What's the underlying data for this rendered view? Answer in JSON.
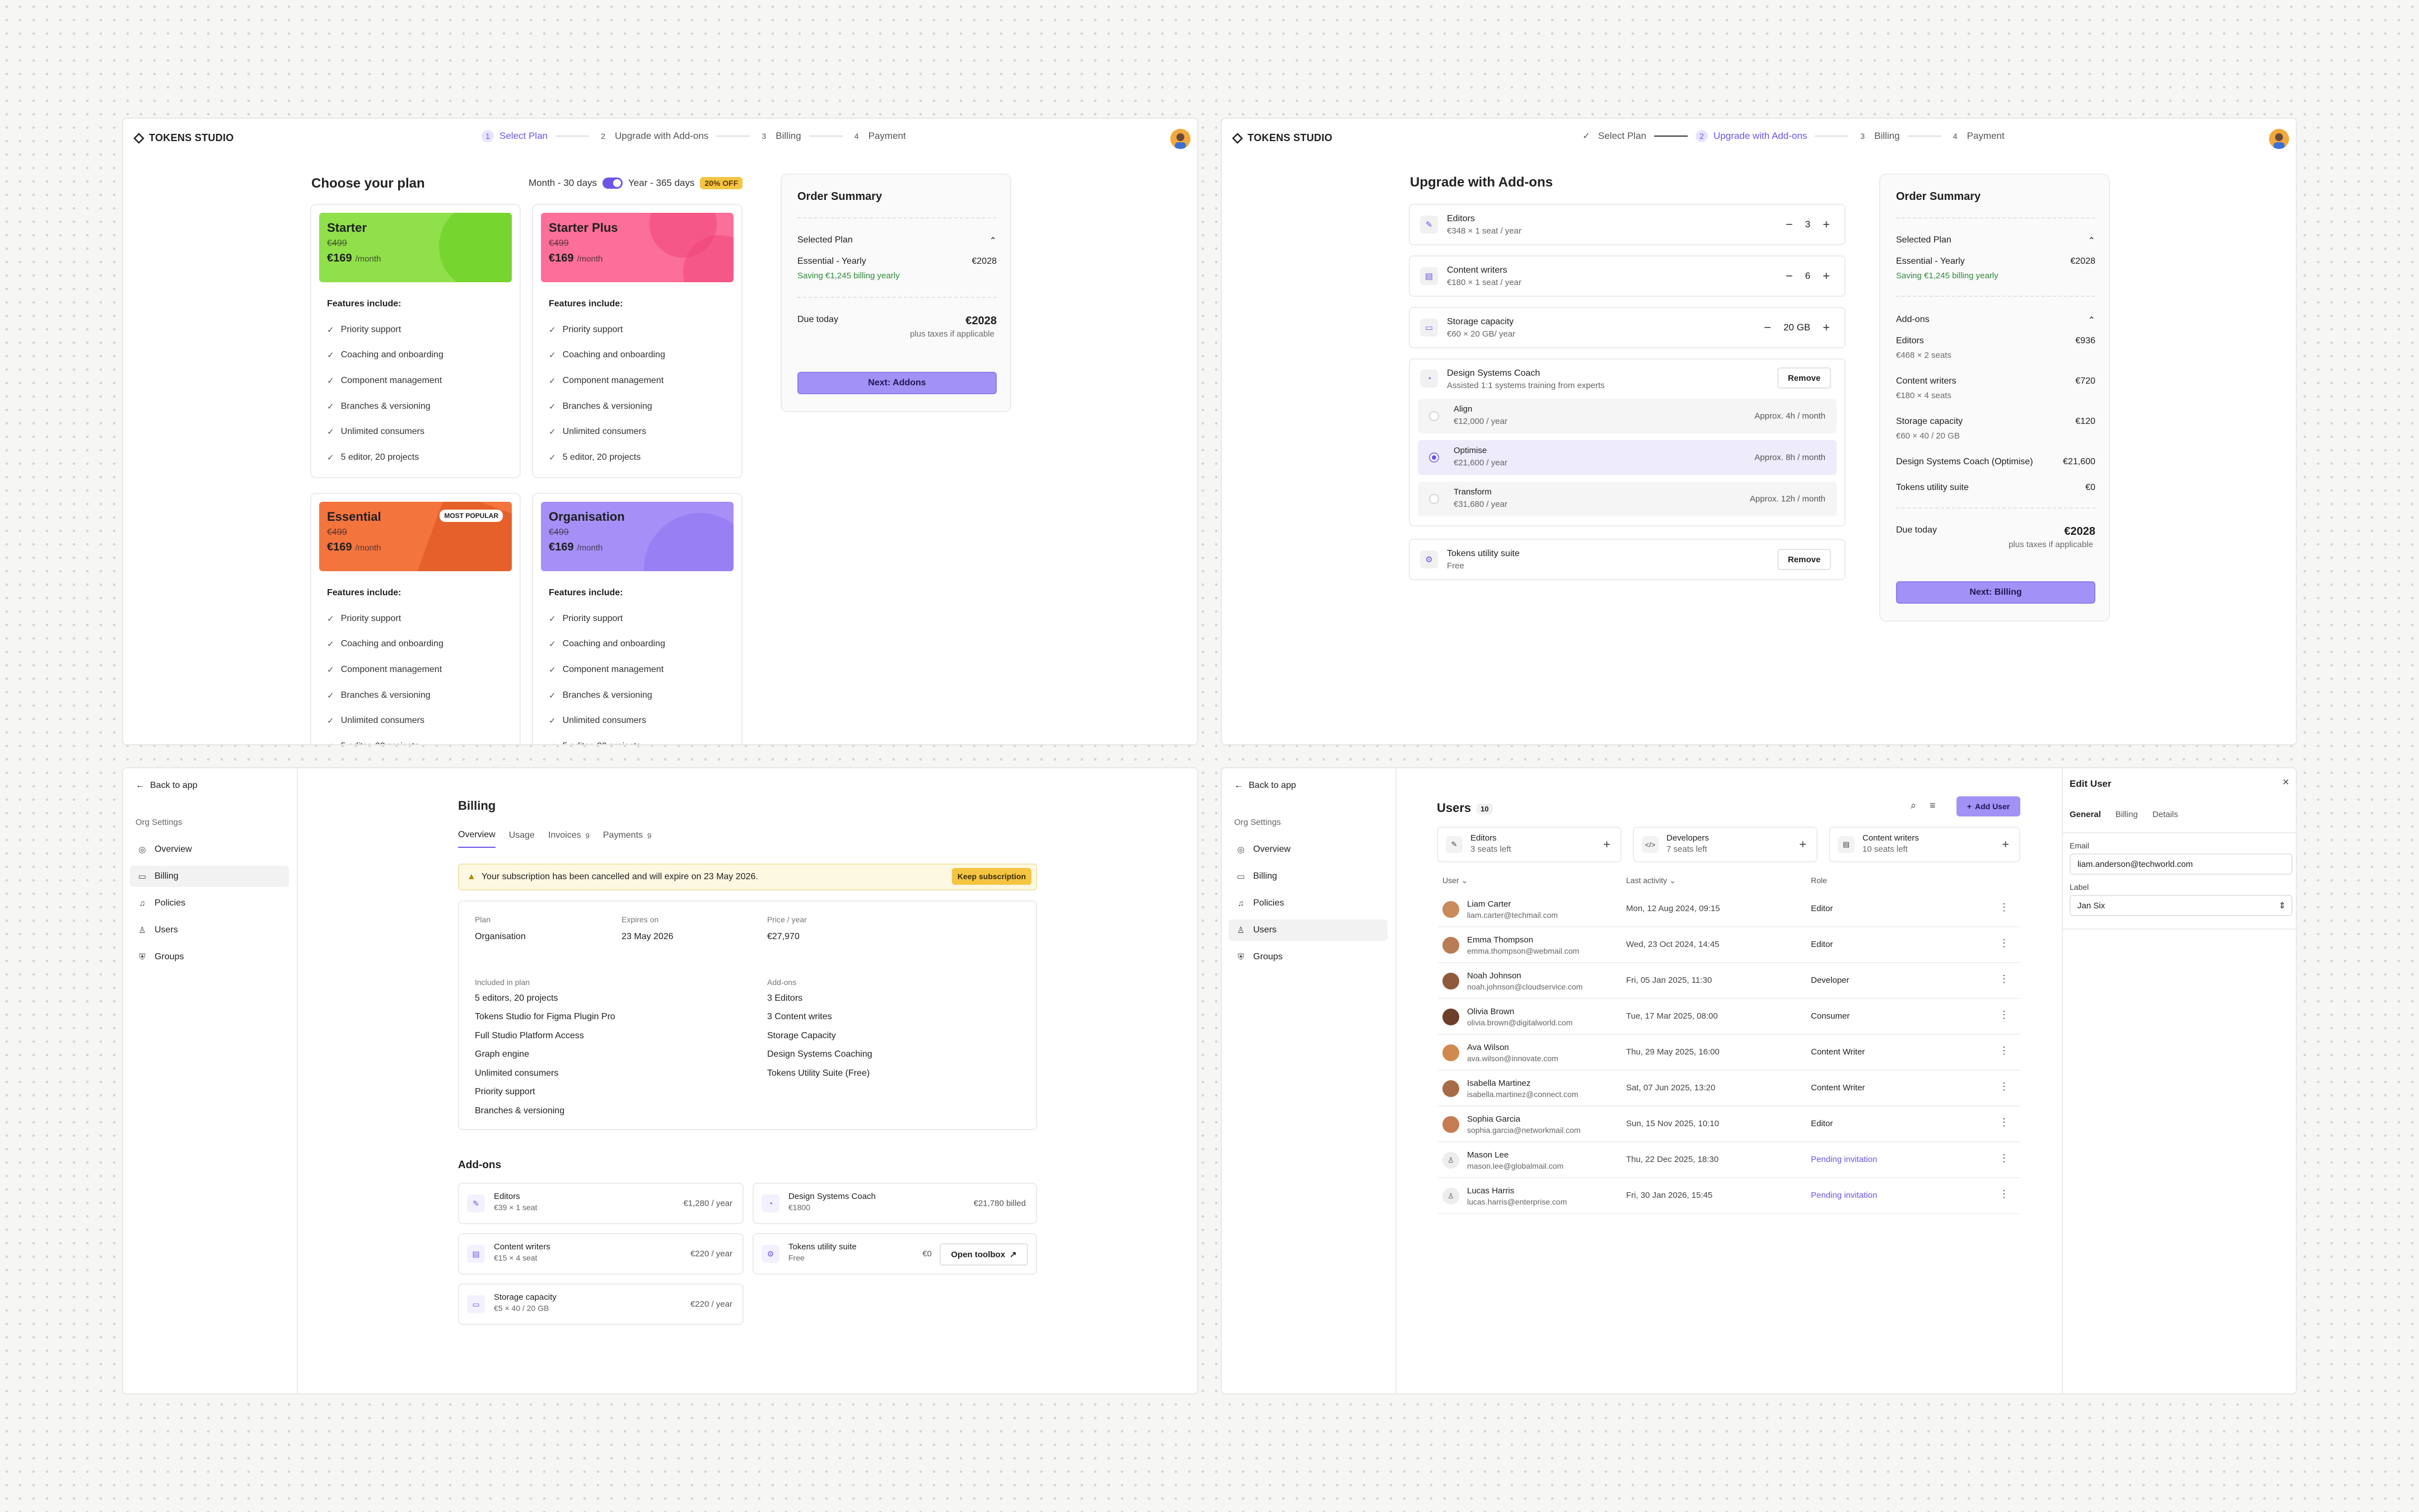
{
  "brand": {
    "name": "TOKENS STUDIO",
    "accent": "#6b56e6"
  },
  "steps": {
    "s1": {
      "num": "1",
      "label": "Select Plan"
    },
    "s2": {
      "num": "2",
      "label": "Upgrade with Add-ons"
    },
    "s3": {
      "num": "3",
      "label": "Billing"
    },
    "s4": {
      "num": "4",
      "label": "Payment"
    }
  },
  "plans": {
    "title": "Choose your plan",
    "toggle_month": "Month - 30 days",
    "toggle_year": "Year - 365 days",
    "discount": "20% OFF",
    "features_heading": "Features include:",
    "features": [
      "Priority support",
      "Coaching and onboarding",
      "Component management",
      "Branches & versioning",
      "Unlimited consumers",
      "5 editor, 20 projects"
    ],
    "per": "/month",
    "popular": "MOST POPULAR",
    "cards": [
      {
        "name": "Starter",
        "old": "€499",
        "price": "€169",
        "color": "#8fe04a"
      },
      {
        "name": "Starter Plus",
        "old": "€499",
        "price": "€169",
        "color": "#fb6f98"
      },
      {
        "name": "Essential",
        "old": "€499",
        "price": "€169",
        "color": "#f4743e"
      },
      {
        "name": "Organisation",
        "old": "€499",
        "price": "€169",
        "color": "#a690f7"
      }
    ]
  },
  "summary1": {
    "title": "Order Summary",
    "selected_plan": "Selected Plan",
    "plan_name": "Essential - Yearly",
    "plan_price": "€2028",
    "saving": "Saving €1,245 billing yearly",
    "due": "Due today",
    "due_value": "€2028",
    "taxes": "plus taxes if applicable",
    "next": "Next: Addons"
  },
  "addons": {
    "title": "Upgrade with Add-ons",
    "editors": {
      "name": "Editors",
      "sub": "€348 × 1 seat / year",
      "qty": "3"
    },
    "writers": {
      "name": "Content writers",
      "sub": "€180 × 1 seat / year",
      "qty": "6"
    },
    "storage": {
      "name": "Storage capacity",
      "sub": "€60 × 20 GB/ year",
      "qty": "20 GB"
    },
    "coach": {
      "name": "Design Systems Coach",
      "sub": "Assisted 1:1 systems training from experts",
      "remove": "Remove"
    },
    "options": [
      {
        "name": "Align",
        "sub": "€12,000 / year",
        "right": "Approx. 4h / month"
      },
      {
        "name": "Optimise",
        "sub": "€21,600 / year",
        "right": "Approx. 8h / month"
      },
      {
        "name": "Transform",
        "sub": "€31,680 / year",
        "right": "Approx. 12h / month"
      }
    ],
    "utility": {
      "name": "Tokens utility suite",
      "sub": "Free",
      "remove": "Remove"
    }
  },
  "summary2": {
    "title": "Order Summary",
    "selected_plan": "Selected Plan",
    "plan_name": "Essential - Yearly",
    "plan_price": "€2028",
    "saving": "Saving €1,245 billing yearly",
    "addons": "Add-ons",
    "items": [
      {
        "name": "Editors",
        "sub": "€468 × 2 seats",
        "price": "€936"
      },
      {
        "name": "Content writers",
        "sub": "€180 × 4 seats",
        "price": "€720"
      },
      {
        "name": "Storage capacity",
        "sub": "€60 × 40 / 20 GB",
        "price": "€120"
      },
      {
        "name": "Design Systems Coach (Optimise)",
        "sub": "",
        "price": "€21,600"
      },
      {
        "name": "Tokens utility suite",
        "sub": "",
        "price": "€0"
      }
    ],
    "due": "Due today",
    "due_value": "€2028",
    "taxes": "plus taxes if applicable",
    "next": "Next: Billing"
  },
  "sidebar": {
    "back": "Back to app",
    "heading": "Org Settings",
    "items": [
      "Overview",
      "Billing",
      "Policies",
      "Users",
      "Groups"
    ]
  },
  "billing": {
    "title": "Billing",
    "tabs": [
      {
        "label": "Overview",
        "count": ""
      },
      {
        "label": "Usage",
        "count": ""
      },
      {
        "label": "Invoices",
        "count": "9"
      },
      {
        "label": "Payments",
        "count": "9"
      }
    ],
    "warning": "Your subscription has been cancelled and will expire on 23 May 2026.",
    "keep": "Keep subscription",
    "plan_label": "Plan",
    "plan_value": "Organisation",
    "expires_label": "Expires on",
    "expires_value": "23 May 2026",
    "price_label": "Price / year",
    "price_value": "€27,970",
    "included_label": "Included in plan",
    "included": [
      "5 editors, 20 projects",
      "Tokens Studio for Figma Plugin Pro",
      "Full Studio Platform Access",
      "Graph engine",
      "Unlimited consumers",
      "Priority support",
      "Branches & versioning"
    ],
    "addons_label": "Add-ons",
    "addons_list": [
      "3 Editors",
      "3 Content writes",
      "Storage Capacity",
      "Design Systems Coaching",
      "Tokens Utility Suite (Free)"
    ],
    "addons_title": "Add-ons",
    "cards": {
      "editors": {
        "name": "Editors",
        "sub": "€39 × 1 seat",
        "price": "€1,280 / year"
      },
      "coach": {
        "name": "Design Systems Coach",
        "sub": "€1800",
        "price": "€21,780 billed"
      },
      "writers": {
        "name": "Content writers",
        "sub": "€15 × 4 seat",
        "price": "€220 / year"
      },
      "utility": {
        "name": "Tokens utility suite",
        "sub": "Free",
        "price": "€0",
        "action": "Open toolbox"
      },
      "storage": {
        "name": "Storage capacity",
        "sub": "€5 × 40 / 20 GB",
        "price": "€220 / year"
      }
    }
  },
  "users": {
    "title": "Users",
    "count": "10",
    "add": "Add User",
    "seats": [
      {
        "name": "Editors",
        "sub": "3 seats left"
      },
      {
        "name": "Developers",
        "sub": "7 seats left"
      },
      {
        "name": "Content writers",
        "sub": "10 seats left"
      }
    ],
    "cols": {
      "user": "User",
      "activity": "Last activity",
      "role": "Role"
    },
    "rows": [
      {
        "name": "Liam Carter",
        "email": "liam.carter@techmail.com",
        "activity": "Mon, 12 Aug 2024, 09:15",
        "role": "Editor"
      },
      {
        "name": "Emma Thompson",
        "email": "emma.thompson@webmail.com",
        "activity": "Wed, 23 Oct 2024, 14:45",
        "role": "Editor"
      },
      {
        "name": "Noah Johnson",
        "email": "noah.johnson@cloudservice.com",
        "activity": "Fri, 05 Jan 2025, 11:30",
        "role": "Developer"
      },
      {
        "name": "Olivia Brown",
        "email": "olivia.brown@digitalworld.com",
        "activity": "Tue, 17 Mar 2025, 08:00",
        "role": "Consumer"
      },
      {
        "name": "Ava Wilson",
        "email": "ava.wilson@innovate.com",
        "activity": "Thu, 29 May 2025, 16:00",
        "role": "Content Writer"
      },
      {
        "name": "Isabella Martinez",
        "email": "isabella.martinez@connect.com",
        "activity": "Sat, 07 Jun 2025, 13:20",
        "role": "Content Writer"
      },
      {
        "name": "Sophia Garcia",
        "email": "sophia.garcia@networkmail.com",
        "activity": "Sun, 15 Nov 2025, 10:10",
        "role": "Editor"
      },
      {
        "name": "Mason Lee",
        "email": "mason.lee@globalmail.com",
        "activity": "Thu, 22 Dec 2025, 18:30",
        "role": "Pending invitation"
      },
      {
        "name": "Lucas Harris",
        "email": "lucas.harris@enterprise.com",
        "activity": "Fri, 30 Jan 2026, 15:45",
        "role": "Pending invitation"
      }
    ]
  },
  "edit_user": {
    "title": "Edit User",
    "tabs": [
      "General",
      "Billing",
      "Details"
    ],
    "email_label": "Email",
    "email_value": "liam.anderson@techworld.com",
    "label_label": "Label",
    "label_value": "Jan Six"
  }
}
